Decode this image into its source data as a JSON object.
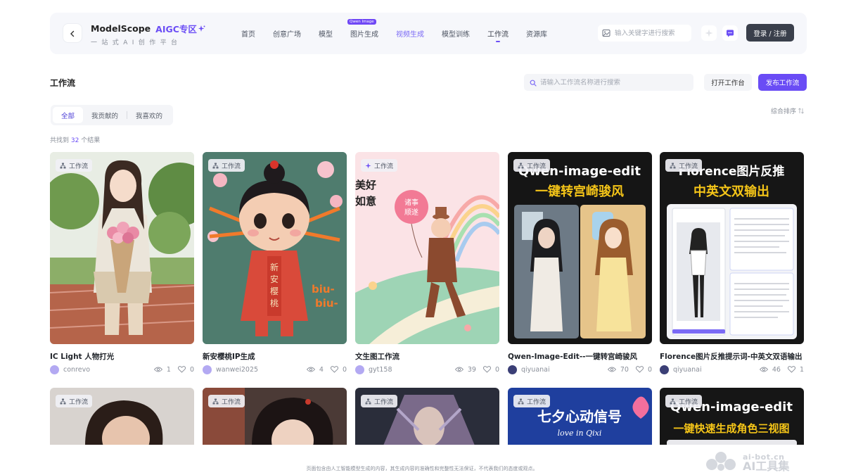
{
  "header": {
    "brand_name": "ModelScope",
    "brand_aigc": "AIGC专区",
    "brand_subtitle": "一站式AI创作平台",
    "back_icon": "chevron-left-icon",
    "nav": [
      {
        "label": "首页"
      },
      {
        "label": "创意广场"
      },
      {
        "label": "模型"
      },
      {
        "label": "图片生成",
        "badge": "Qwen Image"
      },
      {
        "label": "视频生成"
      },
      {
        "label": "模型训练"
      },
      {
        "label": "工作流",
        "active": true
      },
      {
        "label": "资源库"
      }
    ],
    "search_placeholder": "输入关键字进行搜索",
    "login_label": "登录 / 注册"
  },
  "page": {
    "title": "工作流",
    "search_placeholder": "请输入工作流名称进行搜索",
    "open_workbench": "打开工作台",
    "publish": "发布工作流",
    "tabs": [
      "全部",
      "我贡献的",
      "我喜欢的"
    ],
    "active_tab": "全部",
    "sort_label": "综合排序",
    "result_prefix": "共找到",
    "result_count": "32",
    "result_suffix": "个结果"
  },
  "tag_label": "工作流",
  "cards": [
    {
      "title": "IC Light 人物打光",
      "author": "conrevo",
      "views": "1",
      "likes": "0",
      "tag": "工作流"
    },
    {
      "title": "新安樱桃IP生成",
      "author": "wanwei2025",
      "views": "4",
      "likes": "0",
      "tag": "工作流",
      "image_text": [
        "新",
        "安",
        "樱",
        "桃"
      ],
      "image_text2": [
        "biu-",
        "biu-"
      ]
    },
    {
      "title": "文生图工作流",
      "author": "gyt158",
      "views": "39",
      "likes": "0",
      "tag": "工作流",
      "image_text": [
        "美好",
        "如意"
      ],
      "balloon": [
        "诸事",
        "顺遂"
      ]
    },
    {
      "title": "Qwen-Image-Edit--一键转宫崎骏风",
      "author": "qiyuanai",
      "views": "70",
      "likes": "0",
      "tag": "工作流",
      "image_text": [
        "Qwen-image-edit",
        "一键转宫崎骏风"
      ]
    },
    {
      "title": "Florence图片反推提示词-中英文双语输出",
      "author": "qiyuanai",
      "views": "46",
      "likes": "1",
      "tag": "工作流",
      "image_text": [
        "Florence图片反推",
        "中英文双输出"
      ]
    }
  ],
  "cards_row2": [
    {
      "tag": "工作流"
    },
    {
      "tag": "工作流"
    },
    {
      "tag": "工作流"
    },
    {
      "tag": "工作流",
      "image_text": [
        "七夕心动信号",
        "love in Qixi"
      ]
    },
    {
      "tag": "工作流",
      "image_text": [
        "Qwen-image-edit",
        "一键快速生成角色三视图"
      ]
    }
  ],
  "footer_note": "页面包含由人工智能模型生成的内容，其生成内容的准确性和完整性无法保证，不代表我们的态度或观点。",
  "watermark": {
    "line1": "ai-bot.cn",
    "line2": "AI工具集"
  },
  "colors": {
    "accent": "#6a4cf5",
    "dark_button": "#3a3f4b",
    "header_bg": "#f6f7fb"
  }
}
